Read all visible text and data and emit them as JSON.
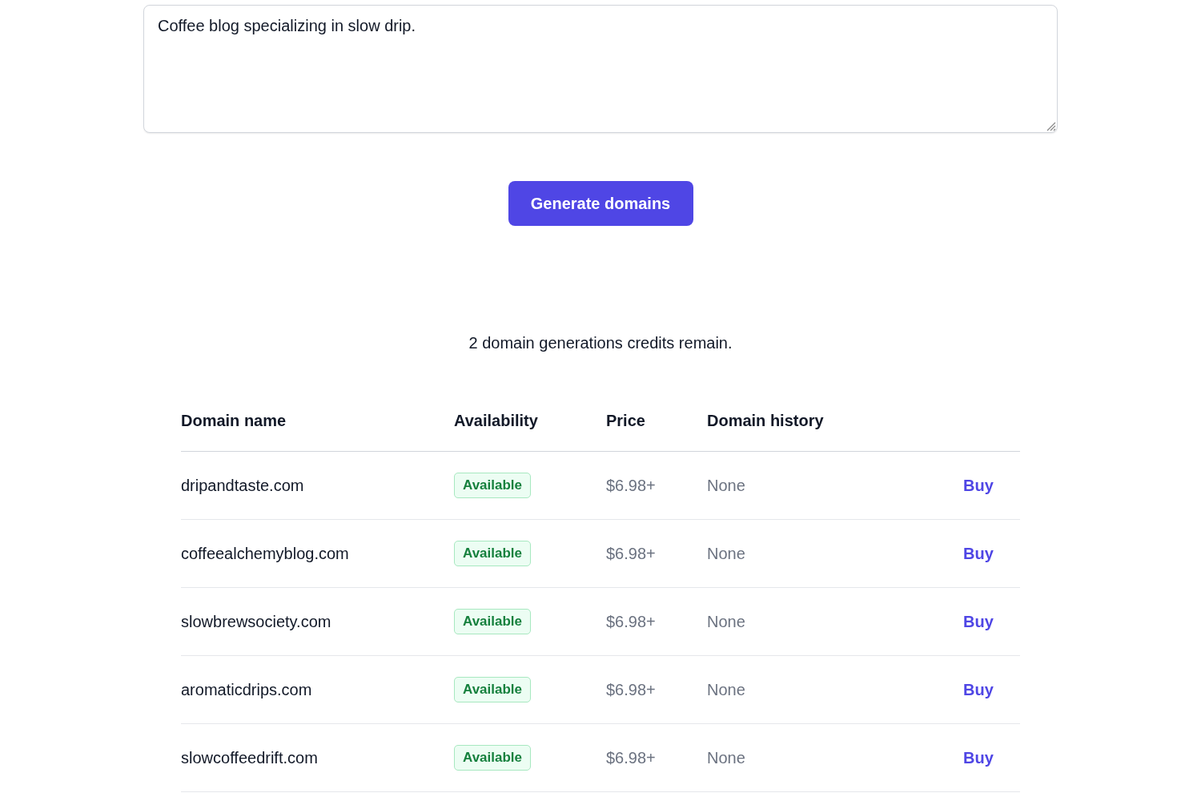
{
  "description": {
    "value": "Coffee blog specializing in slow drip."
  },
  "generate_button": "Generate domains",
  "credits": "2 domain generations credits remain.",
  "table": {
    "columns": [
      "Domain name",
      "Availability",
      "Price",
      "Domain history"
    ],
    "rows": [
      {
        "domain": "dripandtaste.com",
        "availability": "Available",
        "available": true,
        "price": "$6.98+",
        "history": "None",
        "action": "Buy"
      },
      {
        "domain": "coffeealchemyblog.com",
        "availability": "Available",
        "available": true,
        "price": "$6.98+",
        "history": "None",
        "action": "Buy"
      },
      {
        "domain": "slowbrewsociety.com",
        "availability": "Available",
        "available": true,
        "price": "$6.98+",
        "history": "None",
        "action": "Buy"
      },
      {
        "domain": "aromaticdrips.com",
        "availability": "Available",
        "available": true,
        "price": "$6.98+",
        "history": "None",
        "action": "Buy"
      },
      {
        "domain": "slowcoffeedrift.com",
        "availability": "Available",
        "available": true,
        "price": "$6.98+",
        "history": "None",
        "action": "Buy"
      }
    ]
  }
}
